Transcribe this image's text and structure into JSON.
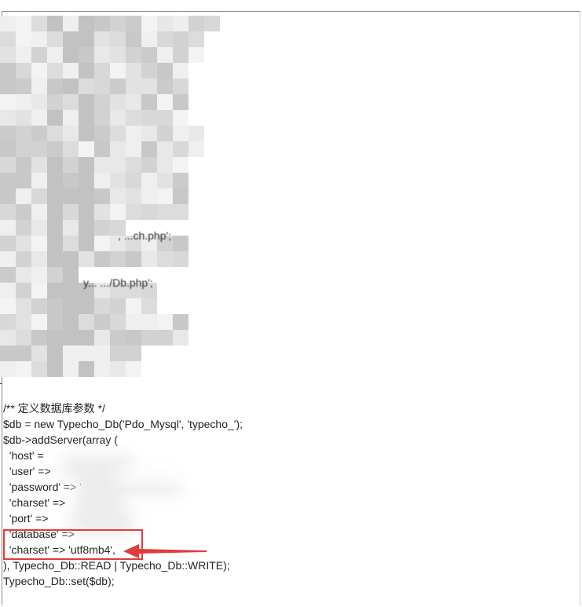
{
  "fragments": {
    "line1_tail": ", ...ch.php';",
    "line2_tail": "y... .../Db.php';"
  },
  "code": {
    "comment": "/** 定义数据库参数 */",
    "db_new": "$db = new Typecho_Db('Pdo_Mysql', 'typecho_');",
    "add_server": "$db->addServer(array (",
    "host": "  'host' =",
    "user": "  'user' =>",
    "password": "  'password' => '",
    "charset_a": "  'charset' =>",
    "port": "  'port' =>",
    "database": "  'database' =>",
    "charset_b": "  'charset' => 'utf8mb4',",
    "close": "), Typecho_Db::READ | Typecho_Db::WRITE);",
    "set": "Typecho_Db::set($db);"
  },
  "colors": {
    "highlight": "#e33a3a",
    "arrow": "#e33a3a"
  },
  "icons": {
    "arrow": "left-arrow-icon"
  }
}
